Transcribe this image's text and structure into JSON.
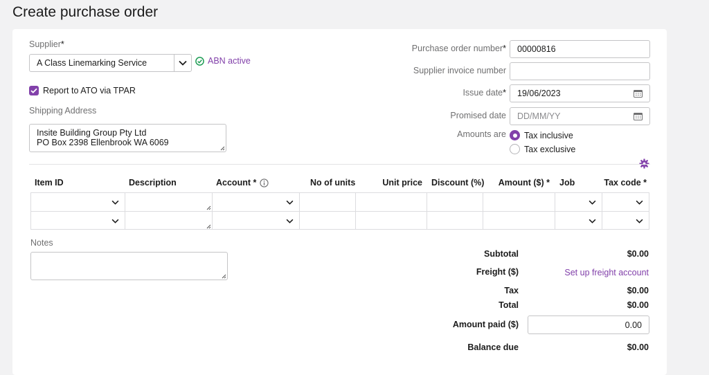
{
  "page": {
    "title": "Create purchase order"
  },
  "colors": {
    "accent": "#8241aa",
    "success": "#1f9d55",
    "border": "#c4c4c6"
  },
  "supplier": {
    "label": "Supplier",
    "required_mark": "*",
    "value": "A Class Linemarking Service",
    "abn_status": "ABN active"
  },
  "report": {
    "label": "Report to ATO via TPAR",
    "checked": true
  },
  "shipping": {
    "label": "Shipping Address",
    "line1": "Insite Building Group Pty Ltd",
    "line2": "PO Box 2398 Ellenbrook WA 6069"
  },
  "po": {
    "number_label": "Purchase order number",
    "number_value": "00000816",
    "supplier_invoice_label": "Supplier invoice number",
    "supplier_invoice_value": "",
    "issue_date_label": "Issue date",
    "issue_date_value": "19/06/2023",
    "promised_date_label": "Promised date",
    "promised_date_placeholder": "DD/MM/YY",
    "required_mark": "*"
  },
  "amounts": {
    "label": "Amounts are",
    "options": [
      "Tax inclusive",
      "Tax exclusive"
    ],
    "selected": "Tax inclusive"
  },
  "table": {
    "headers": {
      "item_id": "Item ID",
      "description": "Description",
      "account": "Account *",
      "units": "No of units",
      "unit_price": "Unit price",
      "discount": "Discount (%)",
      "amount": "Amount ($) *",
      "job": "Job",
      "tax_code": "Tax code *"
    },
    "rows": 2
  },
  "notes": {
    "label": "Notes",
    "value": ""
  },
  "totals": {
    "subtotal_label": "Subtotal",
    "subtotal_value": "$0.00",
    "freight_label": "Freight ($)",
    "freight_link": "Set up freight account",
    "tax_label": "Tax",
    "tax_value": "$0.00",
    "total_label": "Total",
    "total_value": "$0.00",
    "amount_paid_label": "Amount paid ($)",
    "amount_paid_value": "0.00",
    "balance_due_label": "Balance due",
    "balance_due_value": "$0.00"
  },
  "icons": {
    "chevron": "chevron-down-icon",
    "calendar": "calendar-icon",
    "settings": "gear-icon",
    "info": "info-icon",
    "check": "check-circle-icon"
  }
}
